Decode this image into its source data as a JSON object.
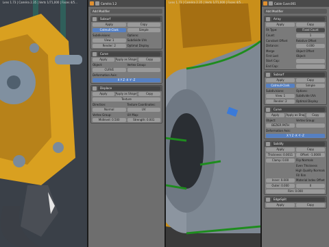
{
  "left_viewport": {
    "header_text": "Lens 1.73 | Caméra 2.35 | Verts 1/71,000 | Faces 4/5..."
  },
  "left_panel": {
    "header_title": "Caméra 1.2",
    "add_modifier": "Add Modifier",
    "modifiers": [
      {
        "name": "Subsurf",
        "apply": "Apply",
        "copy": "Copy",
        "rows": [
          [
            "Catmull-Clark",
            "Simple"
          ],
          [
            "Subdivisions:",
            "Options:"
          ],
          [
            "View: 1",
            "Subdivide UVs"
          ],
          [
            "Render: 2",
            "Optimal Display"
          ]
        ]
      },
      {
        "name": "Curve",
        "apply": "Apply",
        "apply_shape": "Apply as Shape Key",
        "copy": "Copy",
        "rows": [
          [
            "Object:",
            "Vertex Group:"
          ],
          [
            "CURVE",
            ""
          ],
          [
            "Deformation Axis:",
            ""
          ],
          [
            "X  Y  Z  -X  -Y  -Z",
            ""
          ]
        ]
      },
      {
        "name": "Displace",
        "apply": "Apply",
        "apply_shape": "Apply as Shape Key",
        "copy": "Copy",
        "rows": [
          [
            "Texture",
            ""
          ],
          [
            "Direction:",
            "Texture Coordinates:"
          ],
          [
            "Normal",
            "UV"
          ],
          [
            "Vertex Group:",
            "UV Map:"
          ],
          [
            "Midlevel: 0.500",
            "Strength: 0.001"
          ]
        ]
      }
    ]
  },
  "right_viewport": {
    "header_text": "Lens 1.73 | Caméra 2.35 | Verts 1/71,000 | Faces 4/5..."
  },
  "right_panel": {
    "header_title": "Cable Cuve.001",
    "add_modifier": "Add Modifier",
    "modifiers": [
      {
        "name": "Array",
        "apply": "Apply",
        "copy": "Copy",
        "rows": [
          [
            "Fit Type:",
            "Fixed Count"
          ],
          [
            "Count:",
            "1"
          ],
          [
            "Constant Offset",
            "Relative Offset"
          ],
          [
            "Distance:",
            "0.000"
          ],
          [
            "Merge",
            "Object Offset"
          ],
          [
            "First Last",
            "Object:"
          ],
          [
            "Start Cap:",
            ""
          ],
          [
            "End Cap:",
            ""
          ]
        ]
      },
      {
        "name": "Subsurf",
        "apply": "Apply",
        "copy": "Copy",
        "rows": [
          [
            "Catmull-Clark",
            "Simple"
          ],
          [
            "Subdivisions:",
            "Options:"
          ],
          [
            "View: 1",
            "Subdivide UVs"
          ],
          [
            "Render: 2",
            "Optimal Display"
          ]
        ]
      },
      {
        "name": "Curve",
        "apply": "Apply",
        "apply_shape": "Apply as Shape Key",
        "copy": "Copy",
        "rows": [
          [
            "Object:",
            "Vertex Group:"
          ],
          [
            "BEZIER PATH",
            ""
          ],
          [
            "Deformation Axis:",
            ""
          ],
          [
            "X  Y  Z  -X  -Y  -Z",
            ""
          ]
        ]
      },
      {
        "name": "Solidify",
        "apply": "Apply",
        "copy": "Copy",
        "rows": [
          [
            "Thickness: 0.0011",
            "Offset: -1.0000"
          ],
          [
            "Clamp: 0.00",
            "Flip Normals"
          ],
          [
            "",
            "Even Thickness"
          ],
          [
            "",
            "High Quality Normals"
          ],
          [
            "",
            "Fill Rim"
          ],
          [
            "Inner: 0.000",
            "Material Index Offset"
          ],
          [
            "Outer: 0.000",
            "0"
          ],
          [
            "Rim: 0.000",
            ""
          ]
        ]
      },
      {
        "name": "EdgeSplit",
        "apply": "Apply",
        "copy": "Copy",
        "rows": []
      }
    ]
  },
  "colors": {
    "accent_blue": "#5680c2",
    "panel_bg": "#6e6e6e",
    "header_bg": "#4a4a4a",
    "object_yellow": "#e0a020",
    "green_edge": "#1e8c1e"
  }
}
